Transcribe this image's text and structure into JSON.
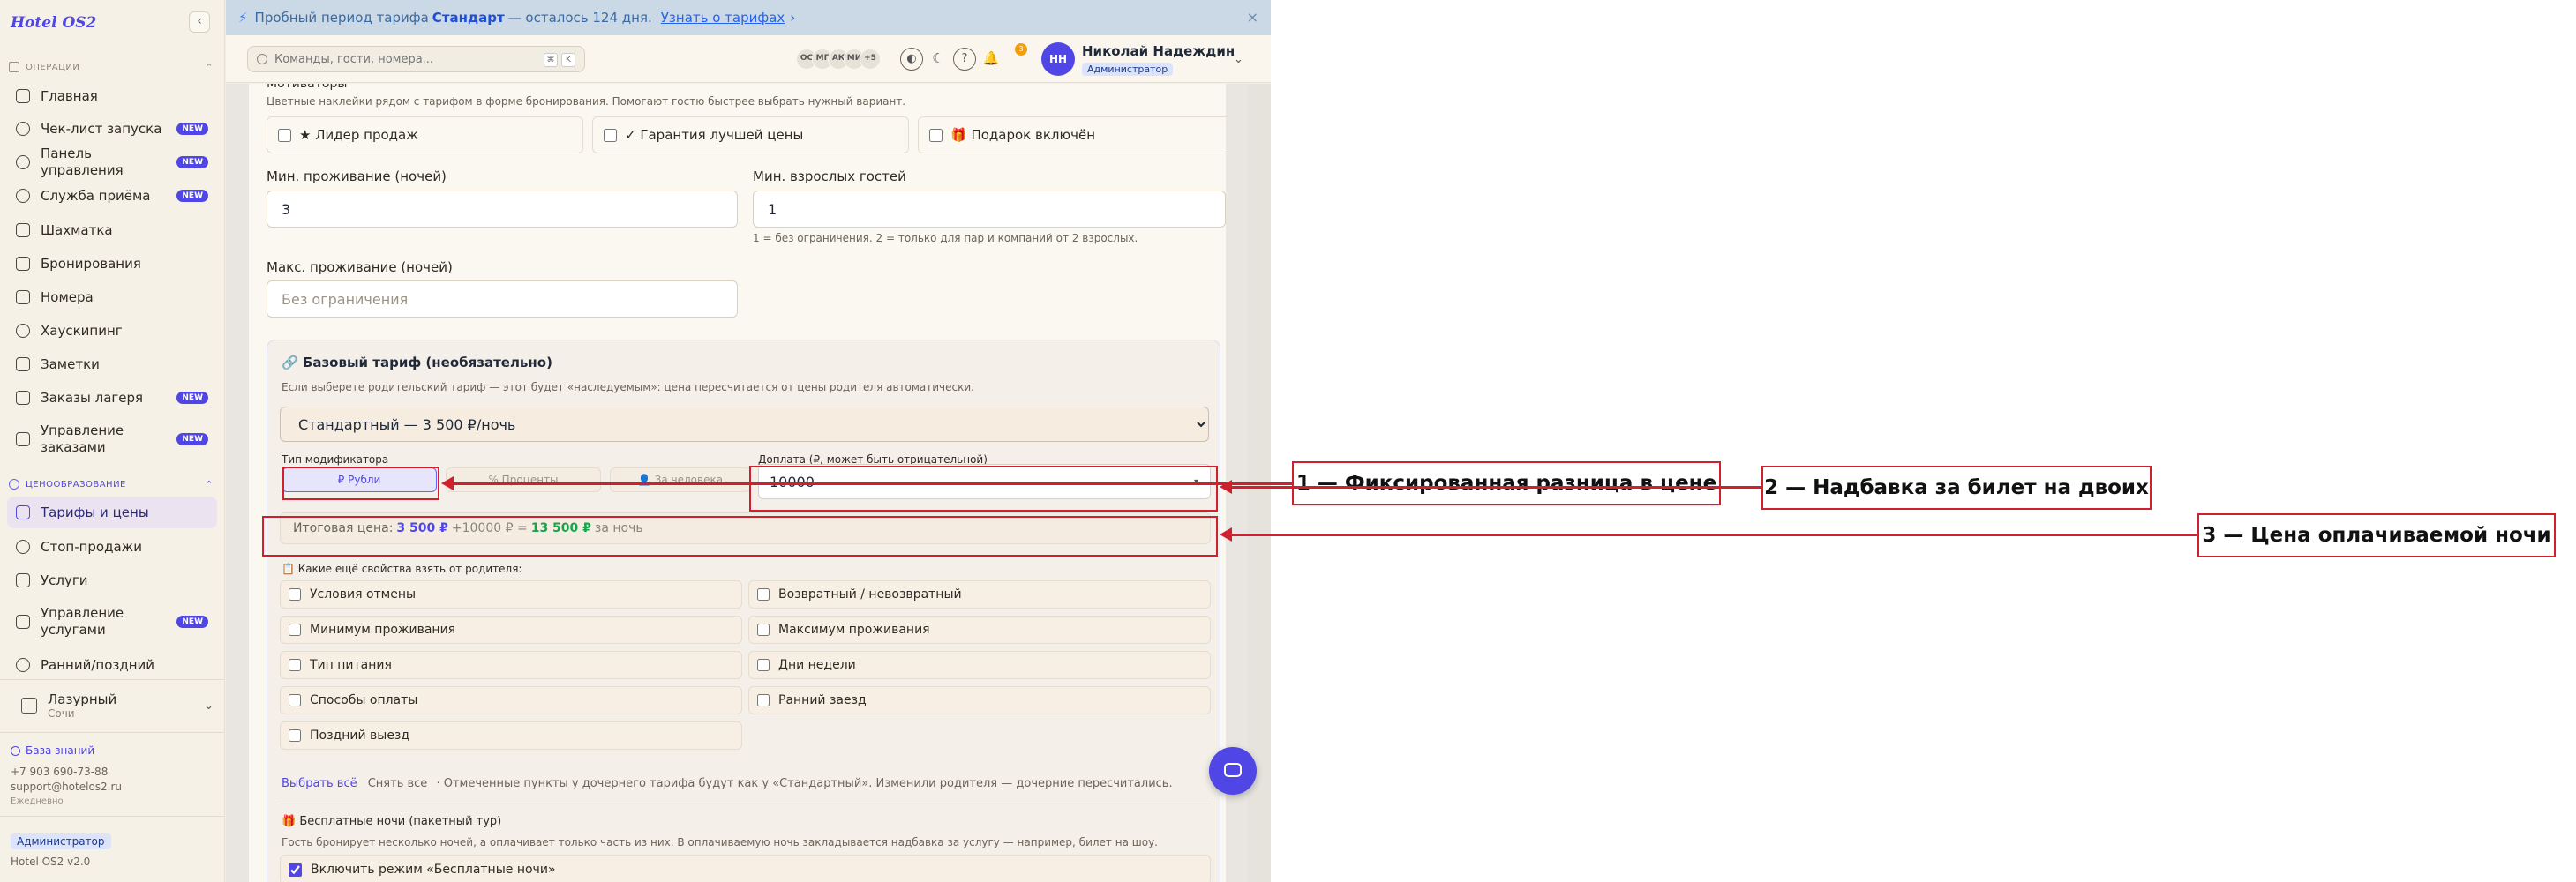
{
  "sidebar": {
    "logo": "Hotel OS2",
    "collapse_icon": "‹",
    "section_operations": "ОПЕРАЦИИ",
    "section_pricing": "ЦЕНООБРАЗОВАНИЕ",
    "new_badge": "NEW",
    "items": [
      {
        "label": "Главная",
        "icon": "grid-icon"
      },
      {
        "label": "Чек-лист запуска",
        "icon": "rocket-icon",
        "new": true
      },
      {
        "label": "Панель управления",
        "icon": "gauge-icon",
        "new": true
      },
      {
        "label": "Служба приёма",
        "icon": "bell-icon",
        "new": true
      },
      {
        "label": "Шахматка",
        "icon": "table-icon"
      },
      {
        "label": "Бронирования",
        "icon": "clipboard-icon"
      },
      {
        "label": "Номера",
        "icon": "door-icon"
      },
      {
        "label": "Хаускипинг",
        "icon": "broom-icon"
      },
      {
        "label": "Заметки",
        "icon": "note-icon"
      },
      {
        "label": "Заказы лагеря",
        "icon": "tent-icon",
        "new": true
      },
      {
        "label": "Управление заказами",
        "icon": "orders-icon",
        "new": true
      },
      {
        "label": "Тарифы и цены",
        "icon": "tag-icon",
        "active": true
      },
      {
        "label": "Стоп-продажи",
        "icon": "stop-icon"
      },
      {
        "label": "Услуги",
        "icon": "tag-icon"
      },
      {
        "label": "Управление услугами",
        "icon": "services-icon",
        "new": true
      },
      {
        "label": "Ранний/поздний",
        "icon": "clock-icon"
      }
    ],
    "hotel": {
      "name": "Лазурный",
      "city": "Сочи"
    },
    "knowledge_base": "База знаний",
    "phone": "+7 903 690-73-88",
    "email": "support@hotelos2.ru",
    "schedule": "Ежедневно",
    "role": "Администратор",
    "version": "Hotel OS2 v2.0"
  },
  "trial": {
    "prefix": "Пробный период тарифа",
    "plan": "Стандарт",
    "suffix": "— осталось 124 дня.",
    "link": "Узнать о тарифах",
    "close": "×"
  },
  "topbar": {
    "search_placeholder": "Команды, гости, номера...",
    "kbd1": "⌘",
    "kbd2": "K",
    "avatars": [
      "ОС",
      "МГ",
      "АК",
      "МИ",
      "+5"
    ],
    "bell_count": "3",
    "user_initials": "НН",
    "user_name": "Николай Надеждин",
    "user_role": "Администратор"
  },
  "form": {
    "motivators_title": "Мотиваторы",
    "motivators_desc": "Цветные наклейки рядом с тарифом в форме бронирования. Помогают гостю быстрее выбрать нужный вариант.",
    "motivators": [
      "★ Лидер продаж",
      "✓ Гарантия лучшей цены",
      "🎁 Подарок включён"
    ],
    "min_stay_label": "Мин. проживание (ночей)",
    "min_stay_value": "3",
    "min_adults_label": "Мин. взрослых гостей",
    "min_adults_value": "1",
    "min_adults_hint": "1 = без ограничения. 2 = только для пар и компаний от 2 взрослых.",
    "max_stay_label": "Макс. проживание (ночей)",
    "max_stay_placeholder": "Без ограничения"
  },
  "base_rate": {
    "title": "🔗 Базовый тариф (необязательно)",
    "desc": "Если выберете родительский тариф — этот будет «наследуемым»: цена пересчитается от цены родителя автоматически.",
    "parent_selected": "Стандартный — 3 500 ₽/ночь",
    "modifier_label": "Тип модификатора",
    "modifiers": [
      "₽ Рубли",
      "% Проценты",
      "👤 За человека"
    ],
    "surcharge_label": "Доплата (₽, может быть отрицательной)",
    "surcharge_value": "10000",
    "total_prefix": "Итоговая цена:",
    "total_base": "3 500 ₽",
    "total_mid": "+10000 ₽ =",
    "total_result": "13 500 ₽",
    "total_suffix": "за ночь",
    "inherit_title": "📋 Какие ещё свойства взять от родителя:",
    "inherit_items": [
      "Условия отмены",
      "Возвратный / невозвратный",
      "Минимум проживания",
      "Максимум проживания",
      "Тип питания",
      "Дни недели",
      "Способы оплаты",
      "Ранний заезд",
      "Поздний выезд"
    ],
    "select_all": "Выбрать всё",
    "clear_all": "Снять все",
    "inherit_note": "· Отмеченные пункты у дочернего тарифа будут как у «Стандартный». Изменили родителя — дочерние пересчитались.",
    "free_title": "🎁 Бесплатные ночи (пакетный тур)",
    "free_desc": "Гость бронирует несколько ночей, а оплачивает только часть из них. В оплачиваемую ночь закладывается надбавка за услугу — например, билет на шоу.",
    "free_toggle": "Включить режим «Бесплатные ночи»"
  },
  "annotations": [
    "1 — Фиксированная разница в цене",
    "2 — Надбавка за билет на двоих",
    "3 — Цена оплачиваемой ночи"
  ],
  "colors": {
    "accent": "#4f46e5",
    "annotation": "#d0202e",
    "success": "#16a34a",
    "sidebar_bg": "#f6f1e7"
  }
}
